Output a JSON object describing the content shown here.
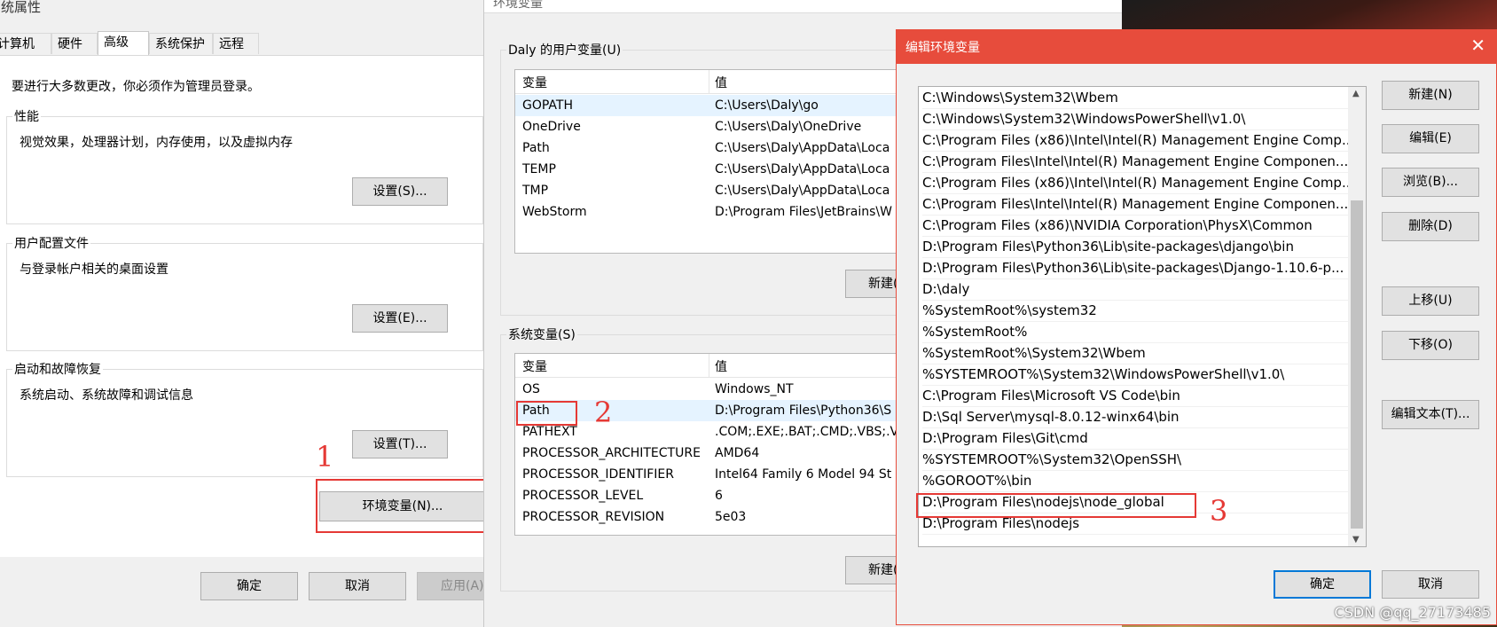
{
  "system_properties": {
    "title": "系统属性",
    "tabs": [
      "计算机名",
      "硬件",
      "高级",
      "系统保护",
      "远程"
    ],
    "admin_note": "要进行大多数更改，你必须作为管理员登录。",
    "performance": {
      "label": "性能",
      "desc": "视觉效果，处理器计划，内存使用，以及虚拟内存",
      "button": "设置(S)..."
    },
    "user_profiles": {
      "label": "用户配置文件",
      "desc": "与登录帐户相关的桌面设置",
      "button": "设置(E)..."
    },
    "startup": {
      "label": "启动和故障恢复",
      "desc": "系统启动、系统故障和调试信息",
      "button": "设置(T)..."
    },
    "env_button": "环境变量(N)...",
    "ok": "确定",
    "cancel": "取消",
    "apply": "应用(A)"
  },
  "env_vars": {
    "title": "环境变量",
    "user_section": "Daly 的用户变量(U)",
    "col_var": "变量",
    "col_value": "值",
    "user_rows": [
      {
        "name": "GOPATH",
        "value": "C:\\Users\\Daly\\go"
      },
      {
        "name": "OneDrive",
        "value": "C:\\Users\\Daly\\OneDrive"
      },
      {
        "name": "Path",
        "value": "C:\\Users\\Daly\\AppData\\Loca"
      },
      {
        "name": "TEMP",
        "value": "C:\\Users\\Daly\\AppData\\Loca"
      },
      {
        "name": "TMP",
        "value": "C:\\Users\\Daly\\AppData\\Loca"
      },
      {
        "name": "WebStorm",
        "value": "D:\\Program Files\\JetBrains\\W"
      }
    ],
    "user_new": "新建(",
    "system_section": "系统变量(S)",
    "system_rows": [
      {
        "name": "OS",
        "value": "Windows_NT"
      },
      {
        "name": "Path",
        "value": "D:\\Program Files\\Python36\\S"
      },
      {
        "name": "PATHEXT",
        "value": ".COM;.EXE;.BAT;.CMD;.VBS;.V"
      },
      {
        "name": "PROCESSOR_ARCHITECTURE",
        "value": "AMD64"
      },
      {
        "name": "PROCESSOR_IDENTIFIER",
        "value": "Intel64 Family 6 Model 94 St"
      },
      {
        "name": "PROCESSOR_LEVEL",
        "value": "6"
      },
      {
        "name": "PROCESSOR_REVISION",
        "value": "5e03"
      }
    ],
    "system_new": "新建("
  },
  "edit_env": {
    "title": "编辑环境变量",
    "close": "✕",
    "paths": [
      "C:\\Windows\\System32\\Wbem",
      "C:\\Windows\\System32\\WindowsPowerShell\\v1.0\\",
      "C:\\Program Files (x86)\\Intel\\Intel(R) Management Engine Comp...",
      "C:\\Program Files\\Intel\\Intel(R) Management Engine Componen...",
      "C:\\Program Files (x86)\\Intel\\Intel(R) Management Engine Comp...",
      "C:\\Program Files\\Intel\\Intel(R) Management Engine Componen...",
      "C:\\Program Files (x86)\\NVIDIA Corporation\\PhysX\\Common",
      "D:\\Program Files\\Python36\\Lib\\site-packages\\django\\bin",
      "D:\\Program Files\\Python36\\Lib\\site-packages\\Django-1.10.6-p...",
      "D:\\daly",
      "%SystemRoot%\\system32",
      "%SystemRoot%",
      "%SystemRoot%\\System32\\Wbem",
      "%SYSTEMROOT%\\System32\\WindowsPowerShell\\v1.0\\",
      "C:\\Program Files\\Microsoft VS Code\\bin",
      "D:\\Sql Server\\mysql-8.0.12-winx64\\bin",
      "D:\\Program Files\\Git\\cmd",
      "%SYSTEMROOT%\\System32\\OpenSSH\\",
      "%GOROOT%\\bin",
      "D:\\Program Files\\nodejs\\node_global",
      "D:\\Program Files\\nodejs"
    ],
    "buttons": [
      "新建(N)",
      "编辑(E)",
      "浏览(B)...",
      "删除(D)",
      "上移(U)",
      "下移(O)",
      "编辑文本(T)..."
    ],
    "ok": "确定",
    "cancel": "取消"
  },
  "annotations": [
    "1",
    "2",
    "3"
  ],
  "watermark": "CSDN @qq_27173485",
  "colors": {
    "annotation_red": "#e53935",
    "titlebar_red": "#e74c3c",
    "selection_blue": "#e5f3ff",
    "focus_blue": "#0078d7"
  }
}
